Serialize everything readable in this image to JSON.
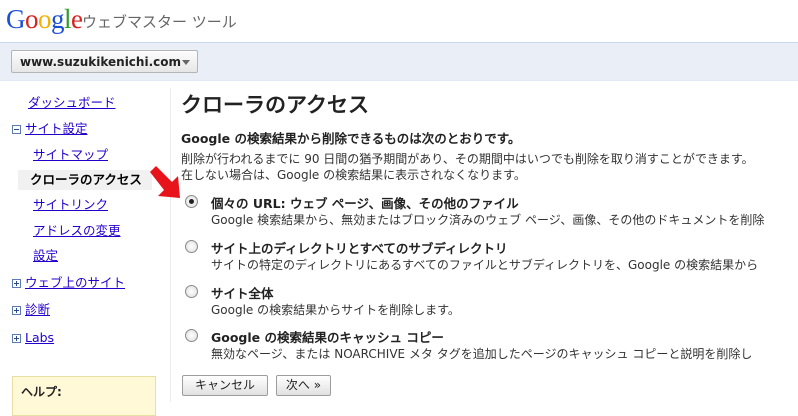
{
  "header": {
    "logo_letters": [
      "G",
      "o",
      "o",
      "g",
      "l",
      "e"
    ],
    "logo_colors": [
      "#1c4fd7",
      "#d3241f",
      "#f0b400",
      "#1c4fd7",
      "#2e9c29",
      "#d3241f"
    ],
    "product": "ウェブマスター ツール"
  },
  "site_selector": {
    "value": "www.suzukikenichi.com"
  },
  "sidebar": {
    "items": [
      {
        "label": "ダッシュボード"
      },
      {
        "label": "サイト設定"
      },
      {
        "label": "サイトマップ"
      },
      {
        "label": "クローラのアクセス"
      },
      {
        "label": "サイトリンク"
      },
      {
        "label": "アドレスの変更"
      },
      {
        "label": "設定"
      },
      {
        "label": "ウェブ上のサイト"
      },
      {
        "label": "診断"
      },
      {
        "label": "Labs"
      }
    ],
    "help_label": "ヘルプ:"
  },
  "main": {
    "title": "クローラのアクセス",
    "intro_title": "Google の検索結果から削除できるものは次のとおりです。",
    "intro_line1": "削除が行われるまでに 90 日間の猶予期間があり、その期間中はいつでも削除を取り消すことができます。",
    "intro_line2": "在しない場合は、Google の検索結果に表示されなくなります。",
    "options": [
      {
        "title": "個々の URL: ウェブ ページ、画像、その他のファイル",
        "desc": "Google 検索結果から、無効またはブロック済みのウェブ ページ、画像、その他のドキュメントを削除",
        "checked": true
      },
      {
        "title": "サイト上のディレクトリとすべてのサブディレクトリ",
        "desc": "サイトの特定のディレクトリにあるすべてのファイルとサブディレクトリを、Google の検索結果から",
        "checked": false
      },
      {
        "title": "サイト全体",
        "desc": "Google の検索結果からサイトを削除します。",
        "checked": false
      },
      {
        "title": "Google の検索結果のキャッシュ コピー",
        "desc": "無効なページ、または NOARCHIVE メタ タグを追加したページのキャッシュ コピーと説明を削除し",
        "checked": false
      }
    ],
    "cancel_label": "キャンセル",
    "next_label": "次へ »"
  }
}
